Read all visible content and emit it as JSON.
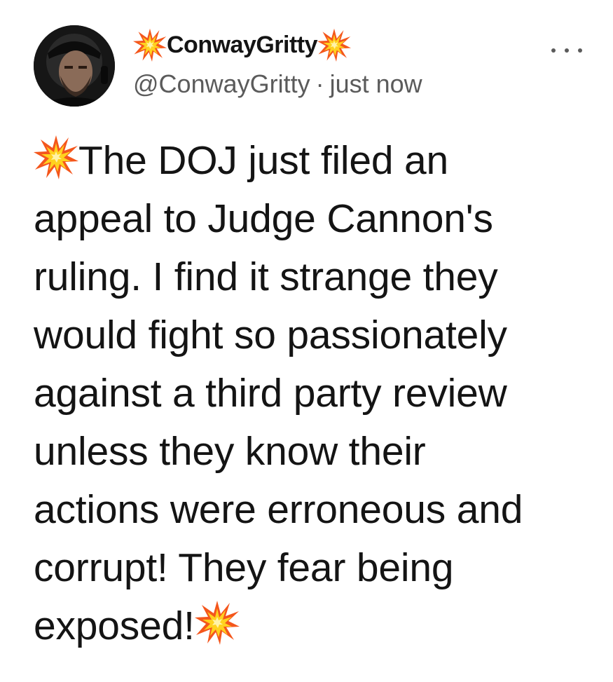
{
  "author": {
    "display_name": "ConwayGritty",
    "handle": "@ConwayGritty",
    "separator": "·",
    "timestamp": "just now",
    "name_prefix_icon": "collision-burst-icon",
    "name_suffix_icon": "collision-burst-icon"
  },
  "menu": {
    "icon": "more-options-icon"
  },
  "tweet": {
    "lines": [
      "The DOJ just filed an",
      "appeal to Judge Cannon's",
      "ruling. I find it strange they",
      "would fight so passionately",
      "against a third party review",
      "unless they know their",
      "actions were erroneous and",
      "corrupt! They fear being",
      "exposed!"
    ],
    "leading_icon": "collision-burst-icon",
    "trailing_icon": "collision-burst-icon"
  },
  "colors": {
    "text_primary": "#141414",
    "text_secondary": "#5b5b5b",
    "burst_outer": "#ff6a00",
    "burst_inner": "#ffd21f"
  }
}
